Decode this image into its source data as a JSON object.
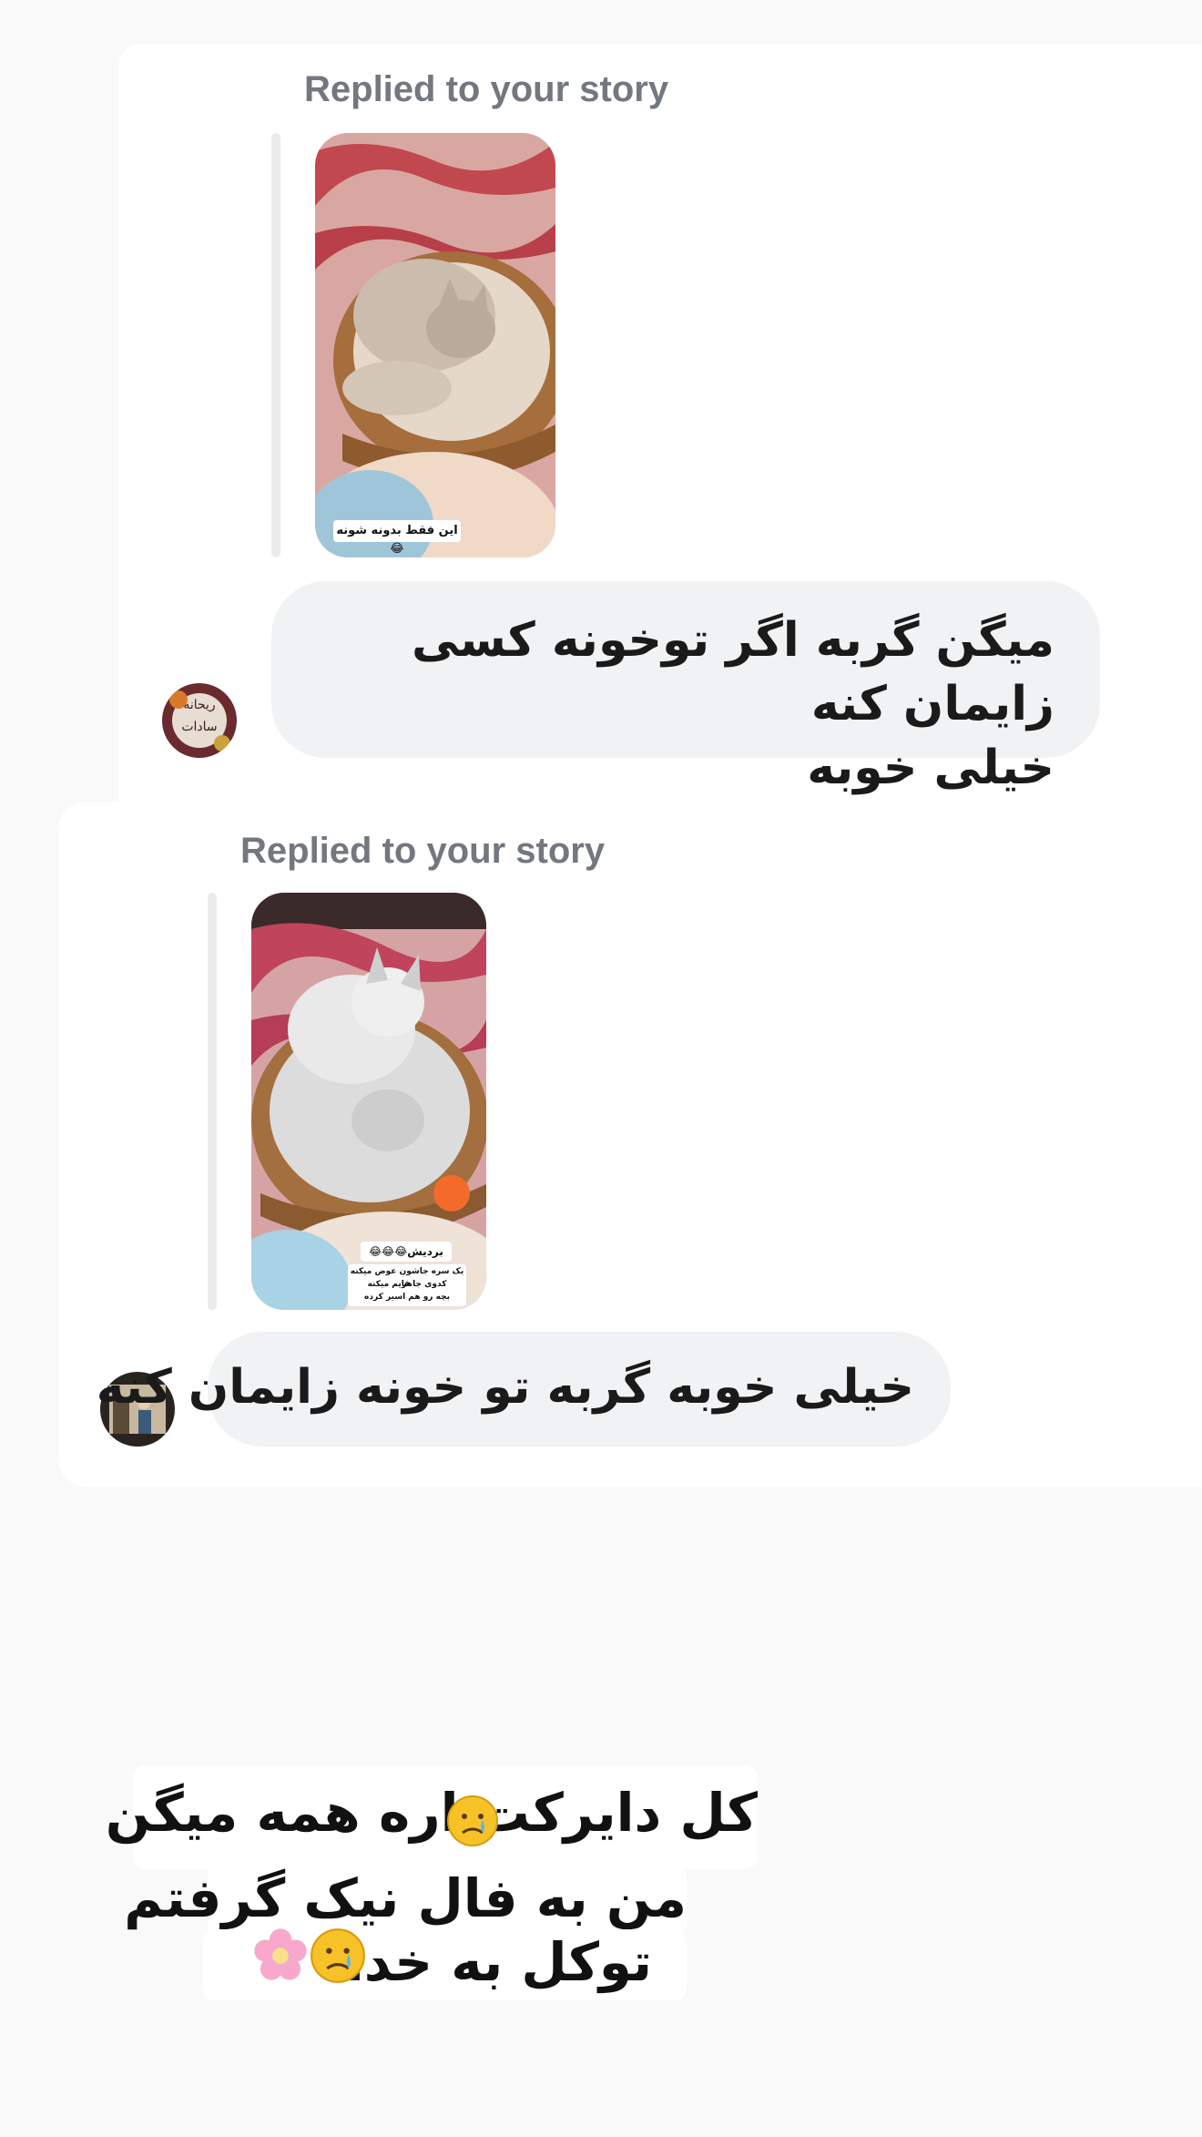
{
  "messages": [
    {
      "replied_label": "Replied to your story",
      "story_caption": "این فقط بدونه شونه😂",
      "text_line1": "میگن گربه اگر توخونه کسی زایمان کنه",
      "text_line2": "خیلی خوبه",
      "avatar_text_line1": "ریحانه",
      "avatar_text_line2": "سادات"
    },
    {
      "replied_label": "Replied to your story",
      "story_caption_title": "بردیش😂😂😂",
      "story_caption_line1": "یک سره جاشون عوض میکنه هر",
      "story_caption_line2": "کدوی جا قایم میکنه",
      "story_caption_line3": "بچه رو هم اسیر کرده",
      "text": "خیلی خوبه گربه تو خونه زایمان کنه"
    }
  ],
  "overlay_caption": {
    "line1": "کل دایرکت اره همه میگن",
    "line2": "من به فال نیک گرفتم",
    "line3": "توکل به خدا"
  }
}
